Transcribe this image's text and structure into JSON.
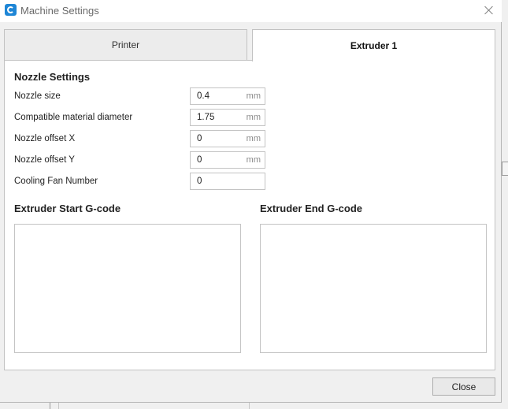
{
  "window": {
    "title": "Machine Settings",
    "close_icon": "close-icon",
    "app_icon": "cura-logo-icon"
  },
  "tabs": [
    {
      "label": "Printer",
      "active": false
    },
    {
      "label": "Extruder 1",
      "active": true
    }
  ],
  "nozzle_settings": {
    "heading": "Nozzle Settings",
    "fields": [
      {
        "label": "Nozzle size",
        "value": "0.4",
        "unit": "mm"
      },
      {
        "label": "Compatible material diameter",
        "value": "1.75",
        "unit": "mm"
      },
      {
        "label": "Nozzle offset X",
        "value": "0",
        "unit": "mm"
      },
      {
        "label": "Nozzle offset Y",
        "value": "0",
        "unit": "mm"
      },
      {
        "label": "Cooling Fan Number",
        "value": "0",
        "unit": ""
      }
    ]
  },
  "gcode": {
    "start_heading": "Extruder Start G-code",
    "start_value": "",
    "end_heading": "Extruder End G-code",
    "end_value": ""
  },
  "footer": {
    "close_label": "Close"
  },
  "colors": {
    "accent": "#1e86d6",
    "border": "#c2c2c2",
    "unit_text": "#8a8a8a"
  }
}
